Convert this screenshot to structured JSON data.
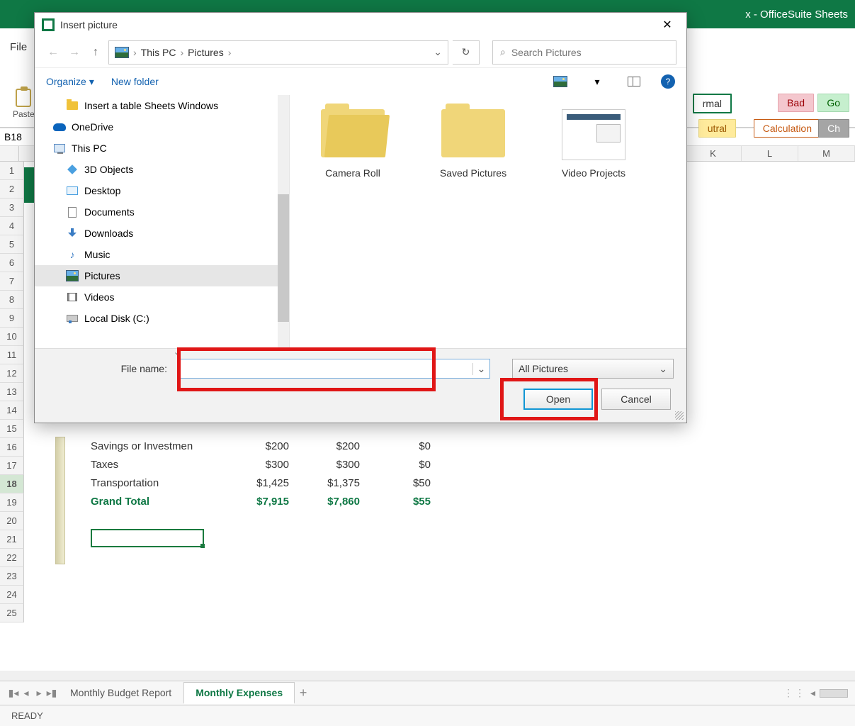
{
  "app": {
    "title_suffix": "x - OfficeSuite Sheets",
    "file_tab": "File",
    "paste_label": "Paste",
    "namebox_value": "B18",
    "style_chips": {
      "normal": "rmal",
      "bad": "Bad",
      "go": "Go",
      "utral": "utral",
      "calculation": "Calculation",
      "ch": "Ch"
    }
  },
  "columns": [
    "K",
    "L",
    "M"
  ],
  "rows_visible": [
    "1",
    "2",
    "3",
    "4",
    "5",
    "6",
    "7",
    "8",
    "9",
    "10",
    "11",
    "12",
    "13",
    "14",
    "15",
    "16",
    "17",
    "18",
    "19",
    "20",
    "21",
    "22",
    "23",
    "24",
    "25"
  ],
  "selected_row": "18",
  "sheet_data": {
    "rows": [
      {
        "label": "Savings or Investmen",
        "a": "$200",
        "b": "$200",
        "c": "$0"
      },
      {
        "label": "Taxes",
        "a": "$300",
        "b": "$300",
        "c": "$0"
      },
      {
        "label": "Transportation",
        "a": "$1,425",
        "b": "$1,375",
        "c": "$50"
      },
      {
        "label": "Grand Total",
        "a": "$7,915",
        "b": "$7,860",
        "c": "$55"
      }
    ]
  },
  "tabs": {
    "nav": {
      "first": "▏◂",
      "prev": "◂",
      "next": "▸",
      "last": "▸▏"
    },
    "items": [
      "Monthly Budget Report",
      "Monthly Expenses"
    ],
    "active_index": 1,
    "add": "+"
  },
  "status": "READY",
  "dialog": {
    "title": "Insert picture",
    "breadcrumbs": [
      "This PC",
      "Pictures"
    ],
    "search_placeholder": "Search Pictures",
    "toolbar": {
      "organize": "Organize",
      "new_folder": "New folder",
      "help": "?"
    },
    "tree": [
      {
        "label": "Insert a table Sheets Windows",
        "icon": "folder",
        "level": 2
      },
      {
        "label": "OneDrive",
        "icon": "onedrive",
        "level": 1
      },
      {
        "label": "This PC",
        "icon": "pc",
        "level": 1
      },
      {
        "label": "3D Objects",
        "icon": "obj3d",
        "level": 2
      },
      {
        "label": "Desktop",
        "icon": "desktop",
        "level": 2
      },
      {
        "label": "Documents",
        "icon": "doc",
        "level": 2
      },
      {
        "label": "Downloads",
        "icon": "download",
        "level": 2
      },
      {
        "label": "Music",
        "icon": "music",
        "level": 2
      },
      {
        "label": "Pictures",
        "icon": "picture",
        "level": 2,
        "selected": true
      },
      {
        "label": "Videos",
        "icon": "video",
        "level": 2
      },
      {
        "label": "Local Disk (C:)",
        "icon": "disk",
        "level": 2
      }
    ],
    "files": [
      {
        "label": "Camera Roll",
        "type": "folder-open"
      },
      {
        "label": "Saved Pictures",
        "type": "folder"
      },
      {
        "label": "Video Projects",
        "type": "project"
      }
    ],
    "footer": {
      "filename_label": "File name:",
      "filename_value": "",
      "filter": "All Pictures",
      "open": "Open",
      "cancel": "Cancel"
    }
  }
}
